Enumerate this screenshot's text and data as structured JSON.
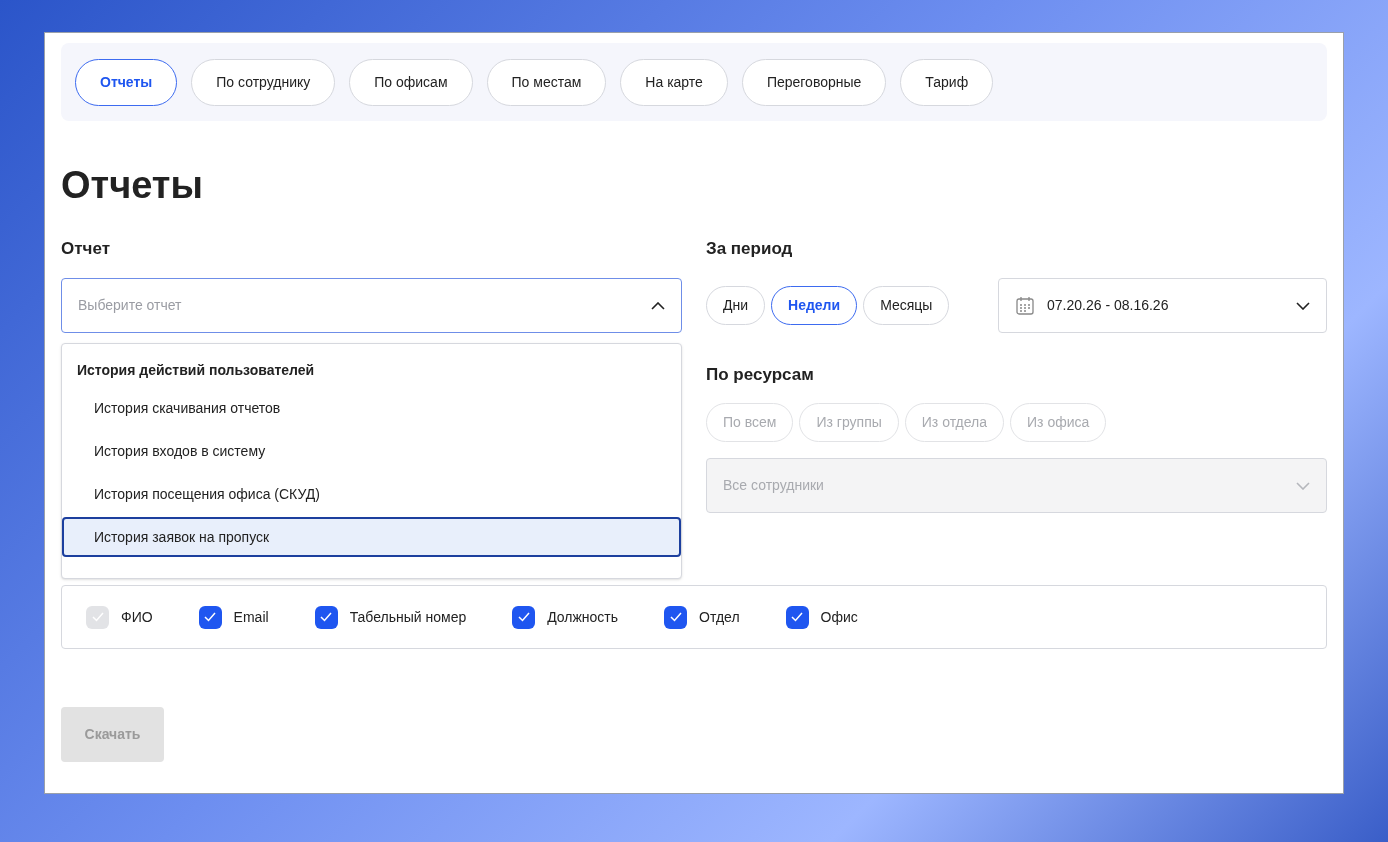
{
  "tabs": [
    {
      "label": "Отчеты",
      "selected": true
    },
    {
      "label": "По сотруднику",
      "selected": false
    },
    {
      "label": "По офисам",
      "selected": false
    },
    {
      "label": "По местам",
      "selected": false
    },
    {
      "label": "На карте",
      "selected": false
    },
    {
      "label": "Переговорные",
      "selected": false
    },
    {
      "label": "Тариф",
      "selected": false
    }
  ],
  "title": "Отчеты",
  "report": {
    "label": "Отчет",
    "placeholder": "Выберите отчет",
    "expanded": true,
    "groups": [
      {
        "heading": "История действий пользователей",
        "items": [
          {
            "label": "История скачивания отчетов",
            "selected": false
          },
          {
            "label": "История входов в систему",
            "selected": false
          },
          {
            "label": "История посещения офиса (СКУД)",
            "selected": false
          },
          {
            "label": "История заявок на пропуск",
            "selected": true
          }
        ]
      }
    ]
  },
  "period": {
    "label": "За период",
    "options": [
      {
        "label": "Дни",
        "selected": false
      },
      {
        "label": "Недели",
        "selected": true
      },
      {
        "label": "Месяцы",
        "selected": false
      }
    ],
    "date_range": "07.20.26 - 08.16.26"
  },
  "resources": {
    "label": "По ресурсам",
    "disabled": true,
    "options": [
      "По всем",
      "Из группы",
      "Из отдела",
      "Из офиса"
    ],
    "placeholder": "Все сотрудники"
  },
  "columns": [
    {
      "label": "ФИО",
      "checked": true,
      "disabled": true
    },
    {
      "label": "Email",
      "checked": true,
      "disabled": false
    },
    {
      "label": "Табельный номер",
      "checked": true,
      "disabled": false
    },
    {
      "label": "Должность",
      "checked": true,
      "disabled": false
    },
    {
      "label": "Отдел",
      "checked": true,
      "disabled": false
    },
    {
      "label": "Офис",
      "checked": true,
      "disabled": false
    }
  ],
  "download": {
    "label": "Скачать",
    "disabled": true
  }
}
